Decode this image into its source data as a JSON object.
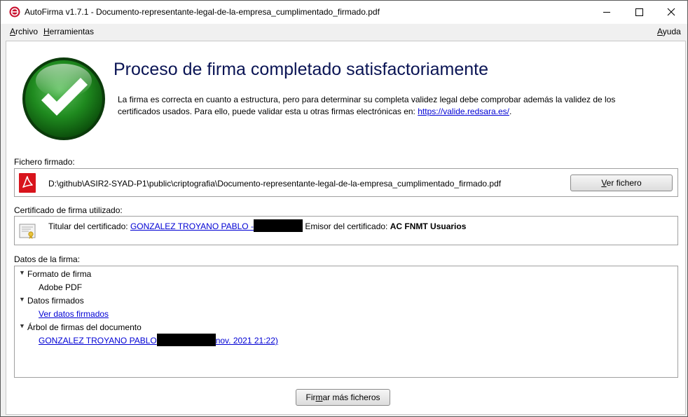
{
  "window": {
    "title": "AutoFirma v1.7.1 - Documento-representante-legal-de-la-empresa_cumplimentado_firmado.pdf"
  },
  "menu": {
    "archivo": {
      "first": "A",
      "rest": "rchivo"
    },
    "herramientas": {
      "first": "H",
      "rest": "erramientas"
    },
    "ayuda": {
      "first": "A",
      "rest": "yuda"
    }
  },
  "result": {
    "heading": "Proceso de firma completado satisfactoriamente",
    "description": "La firma es correcta en cuanto a estructura, pero para determinar su completa validez legal debe comprobar además la validez de los certificados usados. Para ello, puede validar esta u otras firmas electrónicas en: ",
    "link": "https://valide.redsara.es/",
    "description_end": "."
  },
  "file": {
    "label": "Fichero firmado:",
    "path": "D:\\github\\ASIR2-SYAD-P1\\public\\criptografia\\Documento-representante-legal-de-la-empresa_cumplimentado_firmado.pdf",
    "button": {
      "first": "V",
      "rest": "er fichero"
    }
  },
  "certificate": {
    "label": "Certificado de firma utilizado:",
    "holder_label": "Titular del certificado: ",
    "holder_name": "GONZALEZ TROYANO PABLO -",
    "issuer_label": "Emisor del certificado: ",
    "issuer_name": "AC FNMT Usuarios"
  },
  "signature_data": {
    "label": "Datos de la firma:",
    "tree": {
      "format_label": "Formato de firma",
      "format_value": "Adobe PDF",
      "signed_label": "Datos firmados",
      "signed_link": "Ver datos firmados",
      "signers_label": "Árbol de firmas del documento",
      "signer_name": "GONZALEZ TROYANO PABLO",
      "signer_date": "nov. 2021 21:22)"
    }
  },
  "footer": {
    "sign_more": {
      "pre": "Fir",
      "mnem": "m",
      "post": "ar más ficheros"
    }
  },
  "colors": {
    "heading": "#0a1454",
    "link": "#0000d4",
    "success_green": "#1a7a1a"
  }
}
